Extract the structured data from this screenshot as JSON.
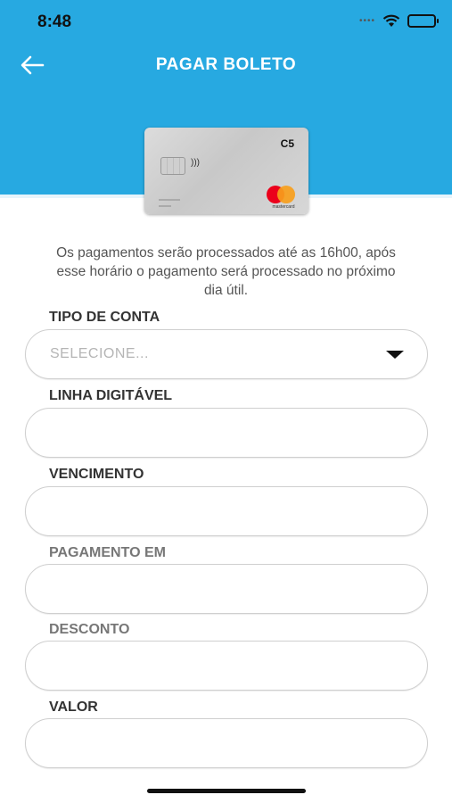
{
  "status_bar": {
    "time": "8:48",
    "signal_icon": "cellular-dots-icon",
    "wifi_icon": "wifi-icon",
    "battery_icon": "battery-icon"
  },
  "header": {
    "title": "PAGAR BOLETO",
    "back_icon": "arrow-left-icon",
    "background_color": "#27a9e1"
  },
  "card": {
    "brand": "C5",
    "network_text": "mastercard"
  },
  "notice": "Os pagamentos serão processados até as 16h00, após esse horário o pagamento será processado no próximo dia útil.",
  "form": {
    "tipo_conta": {
      "label": "TIPO DE CONTA",
      "placeholder": "SELECIONE...",
      "icon": "caret-down-icon"
    },
    "linha_digitavel": {
      "label": "LINHA DIGITÁVEL",
      "value": ""
    },
    "vencimento": {
      "label": "VENCIMENTO",
      "value": ""
    },
    "pagamento_em": {
      "label": "PAGAMENTO EM",
      "value": ""
    },
    "desconto": {
      "label": "DESCONTO",
      "value": ""
    },
    "valor": {
      "label": "VALOR",
      "value": ""
    }
  }
}
